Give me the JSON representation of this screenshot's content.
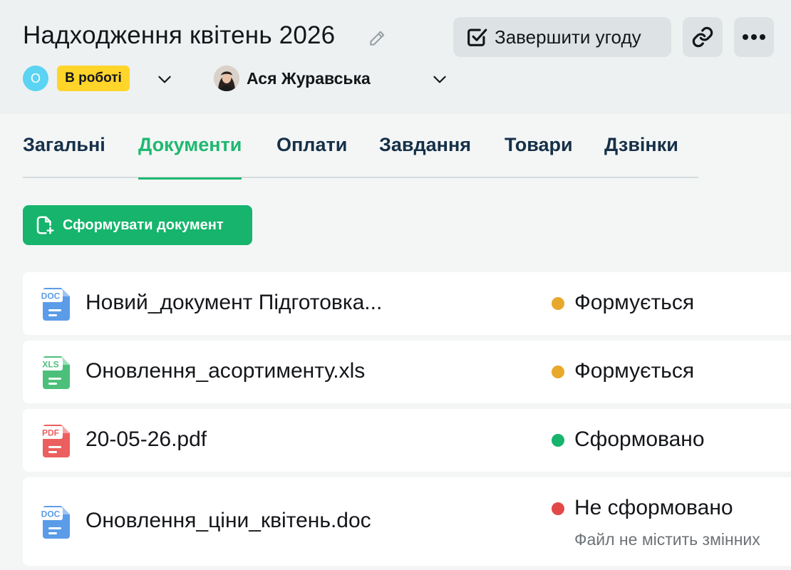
{
  "header": {
    "title": "Надходження квітень 2026",
    "complete_button": "Завершити угоду",
    "status_initial": "О",
    "status_label": "В роботі",
    "user_name": "Ася Журавська"
  },
  "tabs": [
    {
      "label": "Загальні",
      "active": false
    },
    {
      "label": "Документи",
      "active": true
    },
    {
      "label": "Оплати",
      "active": false
    },
    {
      "label": "Завдання",
      "active": false
    },
    {
      "label": "Товари",
      "active": false
    },
    {
      "label": "Дзвінки",
      "active": false
    }
  ],
  "create_button": "Сформувати документ",
  "documents": [
    {
      "type": "DOC",
      "name": "Новий_документ Підготовка...",
      "status": "Формується",
      "status_color": "#e8a82b",
      "note": ""
    },
    {
      "type": "XLS",
      "name": "Оновлення_асортименту.xls",
      "status": "Формується",
      "status_color": "#e8a82b",
      "note": ""
    },
    {
      "type": "PDF",
      "name": "20-05-26.pdf",
      "status": "Сформовано",
      "status_color": "#16b46c",
      "note": ""
    },
    {
      "type": "DOC",
      "name": "Оновлення_ціни_квітень.doc",
      "status": "Не сформовано",
      "status_color": "#e24848",
      "note": "Файл не містить змінних"
    }
  ],
  "colors": {
    "accent": "#1fb870",
    "doc_icon": "#5b9ce8",
    "xls_icon": "#4cc07a",
    "pdf_icon": "#ec5f5f"
  }
}
